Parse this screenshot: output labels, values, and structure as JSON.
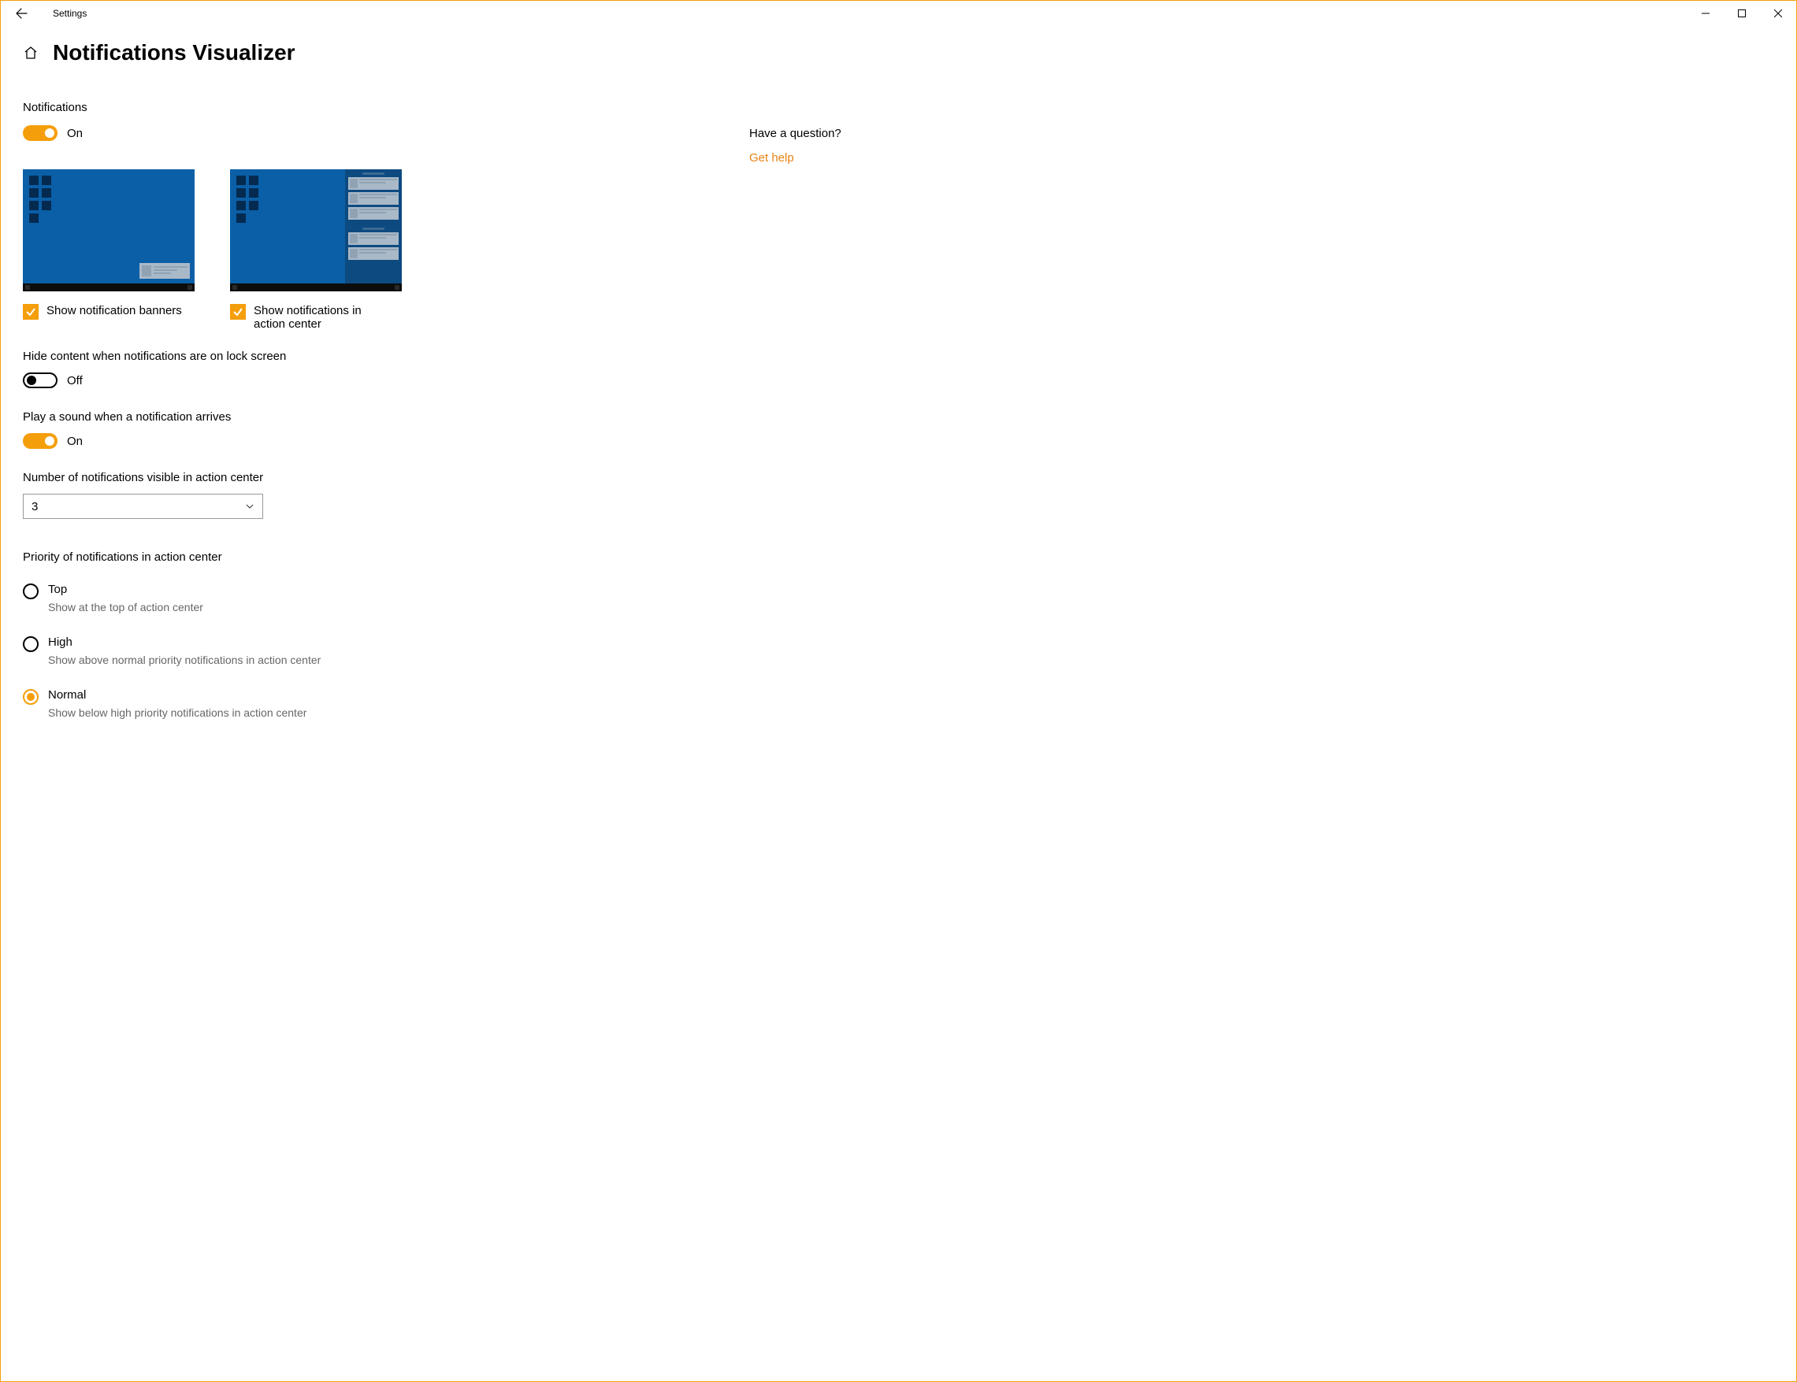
{
  "window": {
    "title": "Settings"
  },
  "page": {
    "title": "Notifications Visualizer"
  },
  "notifications": {
    "label": "Notifications",
    "state": "On"
  },
  "preview": {
    "banner_label": "Show notification banners",
    "ac_label": "Show notifications in action center"
  },
  "hide_content": {
    "label": "Hide content when notifications are on lock screen",
    "state": "Off"
  },
  "play_sound": {
    "label": "Play a sound when a notification arrives",
    "state": "On"
  },
  "number_visible": {
    "label": "Number of notifications visible in action center",
    "value": "3"
  },
  "priority": {
    "label": "Priority of notifications in action center",
    "options": [
      {
        "title": "Top",
        "desc": "Show at the top of action center"
      },
      {
        "title": "High",
        "desc": "Show above normal priority notifications in action center"
      },
      {
        "title": "Normal",
        "desc": "Show below high priority notifications in action center"
      }
    ]
  },
  "help": {
    "heading": "Have a question?",
    "link": "Get help"
  }
}
